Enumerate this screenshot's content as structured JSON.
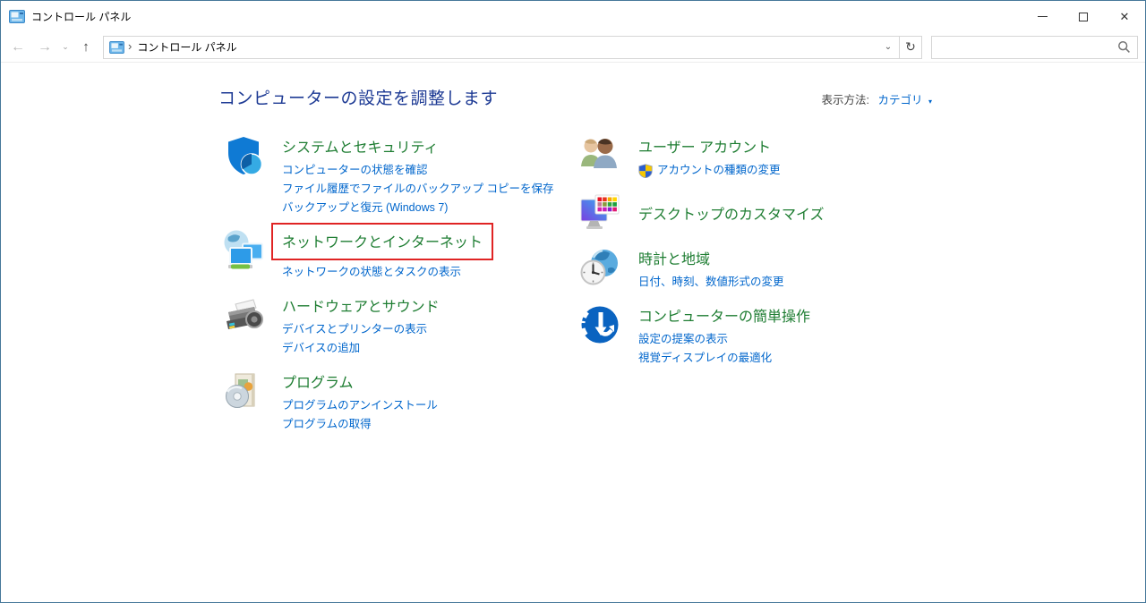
{
  "window": {
    "title": "コントロール パネル",
    "controls": {
      "close": "✕"
    }
  },
  "icons": {
    "back": "←",
    "forward": "→",
    "history_dropdown": "⌄",
    "up": "↑",
    "breadcrumb_chevron": "›",
    "address_dropdown": "⌄",
    "refresh": "↻",
    "view_dropdown": "▾"
  },
  "navbar": {
    "breadcrumb_root": "コントロール パネル"
  },
  "search": {
    "value": "",
    "placeholder": ""
  },
  "header": {
    "title": "コンピューターの設定を調整します",
    "view_by_label": "表示方法:",
    "view_by_value": "カテゴリ"
  },
  "categories": {
    "left": [
      {
        "title": "システムとセキュリティ",
        "icon": "system-security-shield-icon",
        "links": [
          "コンピューターの状態を確認",
          "ファイル履歴でファイルのバックアップ コピーを保存",
          "バックアップと復元 (Windows 7)"
        ]
      },
      {
        "title": "ネットワークとインターネット",
        "icon": "network-internet-icon",
        "highlighted": true,
        "links": [
          "ネットワークの状態とタスクの表示"
        ]
      },
      {
        "title": "ハードウェアとサウンド",
        "icon": "hardware-sound-icon",
        "links": [
          "デバイスとプリンターの表示",
          "デバイスの追加"
        ]
      },
      {
        "title": "プログラム",
        "icon": "programs-icon",
        "links": [
          "プログラムのアンインストール",
          "プログラムの取得"
        ]
      }
    ],
    "right": [
      {
        "title": "ユーザー アカウント",
        "icon": "user-accounts-icon",
        "links": [
          "アカウントの種類の変更"
        ]
      },
      {
        "title": "デスクトップのカスタマイズ",
        "icon": "appearance-personalization-icon",
        "links": []
      },
      {
        "title": "時計と地域",
        "icon": "clock-region-icon",
        "links": [
          "日付、時刻、数値形式の変更"
        ]
      },
      {
        "title": "コンピューターの簡単操作",
        "icon": "ease-of-access-icon",
        "links": [
          "設定の提案の表示",
          "視覚ディスプレイの最適化"
        ]
      }
    ]
  },
  "colors": {
    "category_title_green": "#1e7d32",
    "task_link_blue": "#0066cc",
    "heading_navy": "#1d3a94",
    "highlight_red": "#e02424",
    "window_border": "#46789a"
  }
}
